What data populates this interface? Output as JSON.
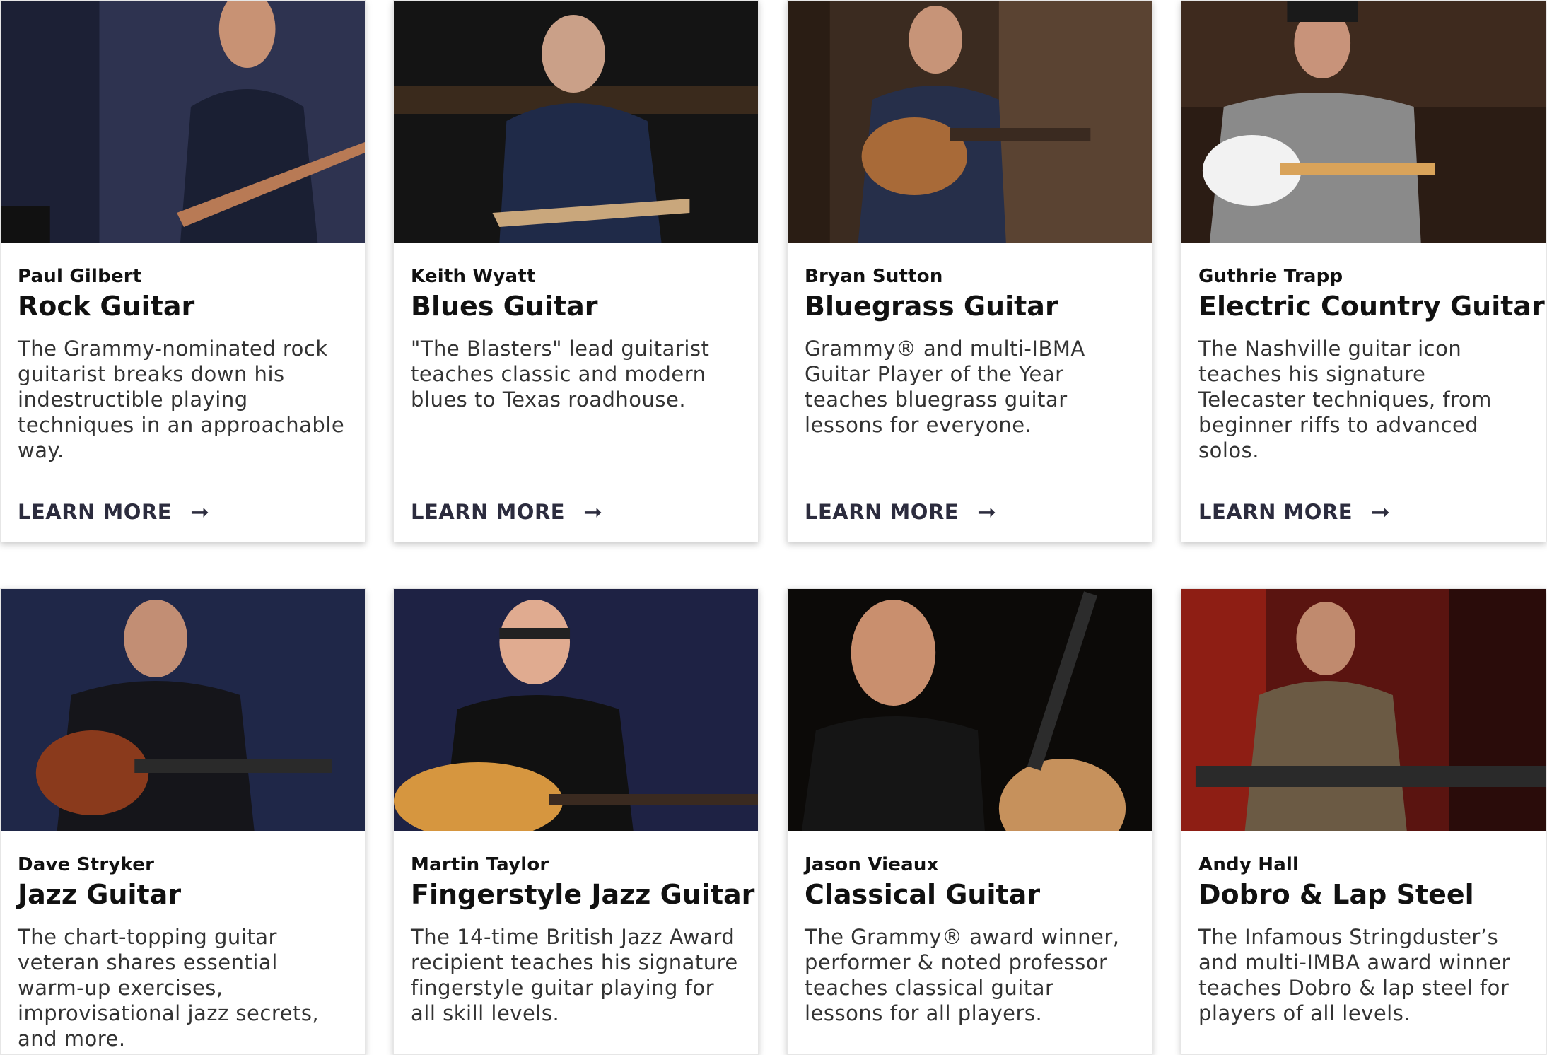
{
  "cards": [
    {
      "instructor": "Paul Gilbert",
      "course": "Rock Guitar",
      "description": "The Grammy-nominated rock guitarist breaks down his indestructible playing techniques in an approachable way.",
      "cta": "LEARN MORE"
    },
    {
      "instructor": "Keith Wyatt",
      "course": "Blues Guitar",
      "description": "\"The Blasters\" lead guitarist teaches classic and modern blues to Texas roadhouse.",
      "cta": "LEARN MORE"
    },
    {
      "instructor": "Bryan Sutton",
      "course": "Bluegrass Guitar",
      "description": "Grammy® and multi-IBMA Guitar Player of the Year teaches bluegrass guitar lessons for everyone.",
      "cta": "LEARN MORE"
    },
    {
      "instructor": "Guthrie Trapp",
      "course": "Electric Country Guitar",
      "description": "The Nashville guitar icon teaches his signature Telecaster techniques, from beginner riffs to advanced solos.",
      "cta": "LEARN MORE"
    },
    {
      "instructor": "Dave Stryker",
      "course": "Jazz Guitar",
      "description": "The chart-topping guitar veteran shares essential warm-up exercises, improvisational jazz secrets, and more."
    },
    {
      "instructor": "Martin Taylor",
      "course": "Fingerstyle Jazz Guitar",
      "description": "The 14-time British Jazz Award recipient teaches his signature fingerstyle guitar playing for all skill levels."
    },
    {
      "instructor": "Jason Vieaux",
      "course": "Classical Guitar",
      "description": "The Grammy® award winner, performer & noted professor teaches classical guitar lessons for all players."
    },
    {
      "instructor": "Andy Hall",
      "course": "Dobro & Lap Steel",
      "description": "The Infamous Stringduster’s and multi-IMBA award winner teaches Dobro & lap steel for players of all levels."
    }
  ],
  "arrow_icon": "arrow-right-icon",
  "colors": {
    "cta": "#2c2c3e",
    "heading": "#111111",
    "body_text": "#333333"
  }
}
